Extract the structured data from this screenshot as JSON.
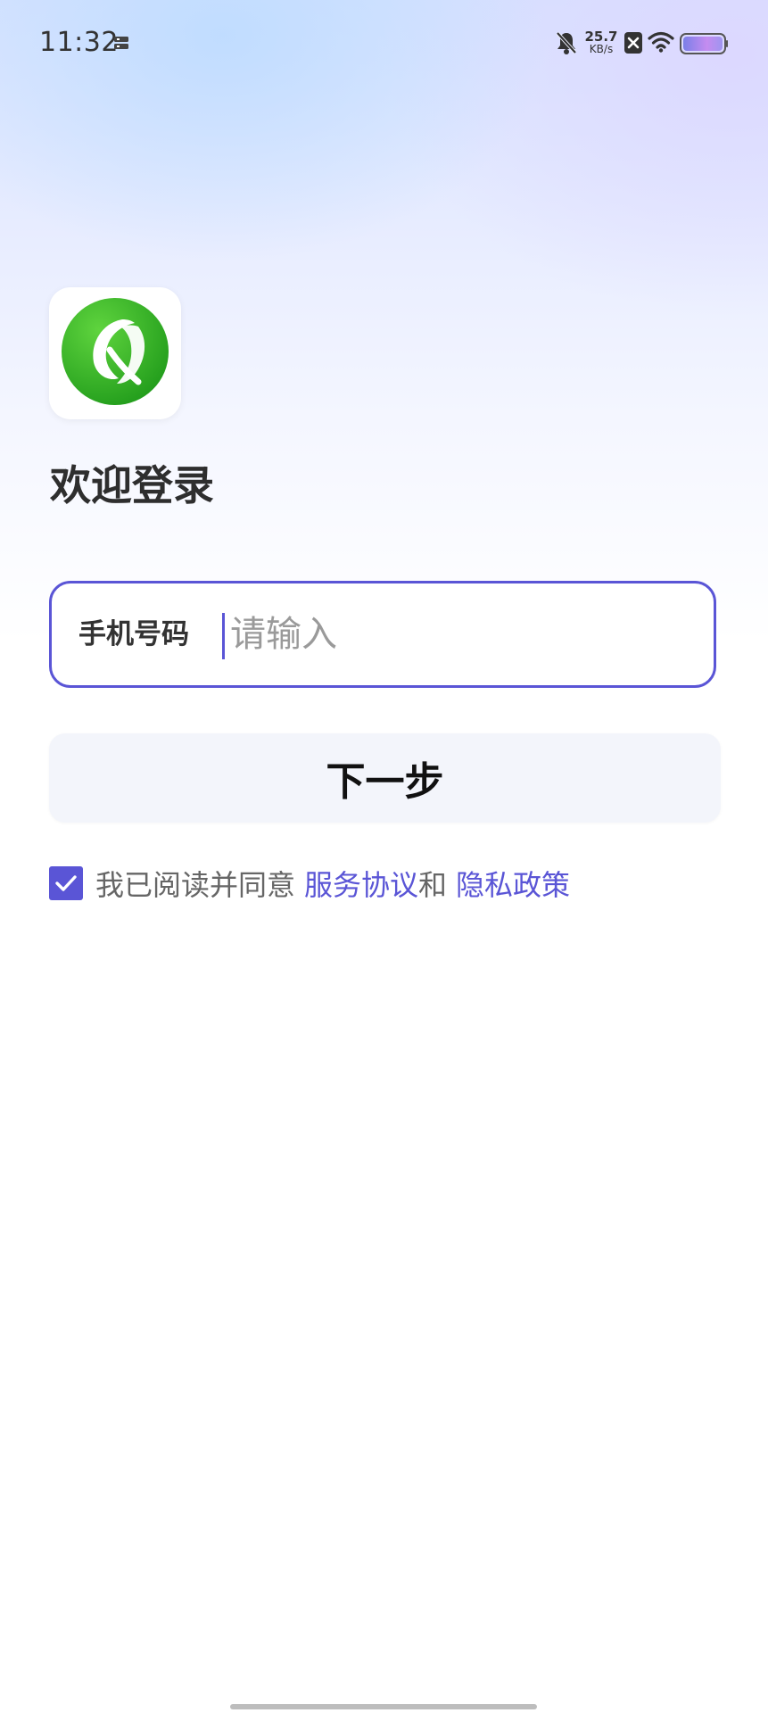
{
  "status_bar": {
    "time": "11:32",
    "net_speed_value": "25.7",
    "net_speed_unit": "KB/s",
    "icons": [
      "sim-icon",
      "mute-bell-icon",
      "xbox-icon",
      "wifi-icon",
      "battery-icon"
    ]
  },
  "app": {
    "logo_icon": "green-leaf-logo-icon",
    "title": "欢迎登录"
  },
  "form": {
    "phone_label": "手机号码",
    "phone_placeholder": "请输入",
    "phone_value": "",
    "next_button": "下一步"
  },
  "agreement": {
    "checked": true,
    "text": "我已阅读并同意",
    "service_link": "服务协议",
    "and": "和",
    "privacy_link": "隐私政策"
  },
  "colors": {
    "accent": "#5a55d6",
    "logo_green": "#3cb82e"
  }
}
